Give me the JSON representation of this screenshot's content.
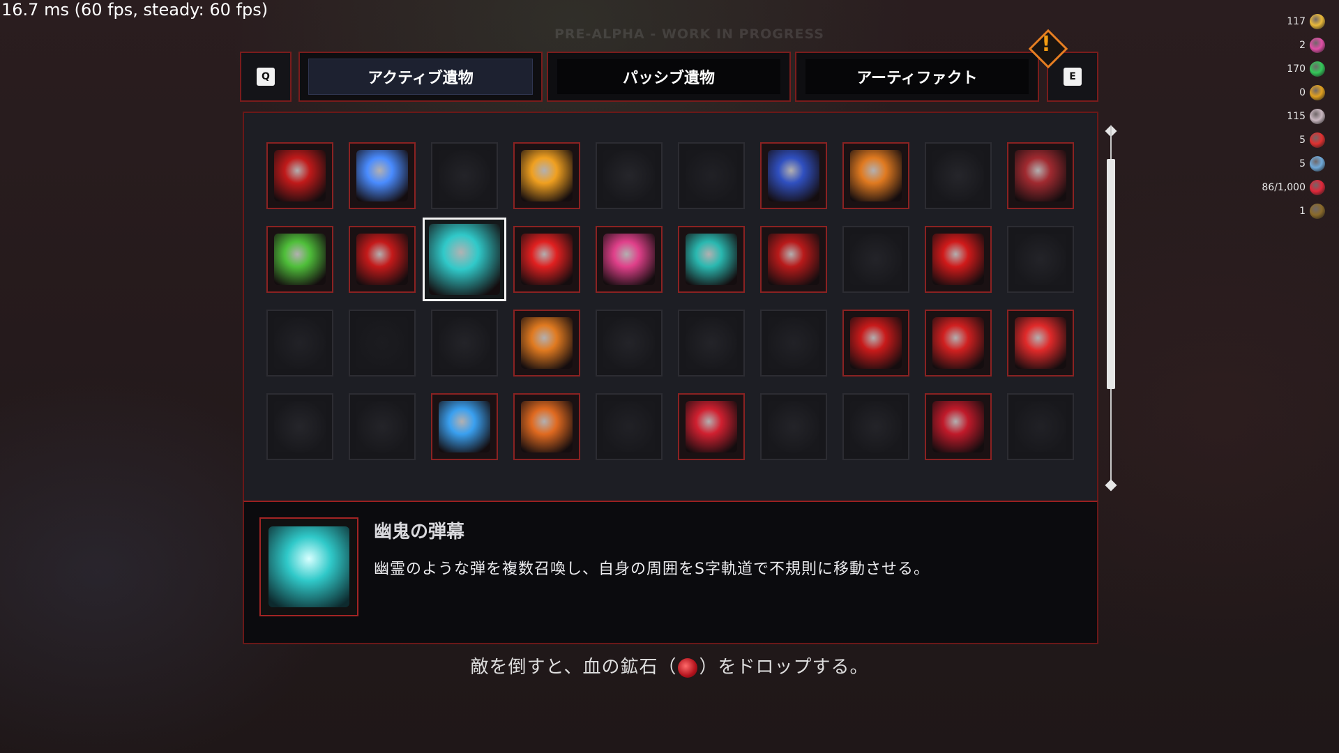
{
  "debug": {
    "fps_text": "16.7 ms (60 fps, steady: 60 fps)",
    "watermark": "PRE-ALPHA - WORK IN PROGRESS"
  },
  "resources": [
    {
      "value": "117",
      "icon": "gold-icon",
      "color": "#e9b93a"
    },
    {
      "value": "2",
      "icon": "pink-crystal-icon",
      "color": "#e04fa6"
    },
    {
      "value": "170",
      "icon": "green-gem-icon",
      "color": "#34c759"
    },
    {
      "value": "0",
      "icon": "gold-coin-icon",
      "color": "#e0a020"
    },
    {
      "value": "115",
      "icon": "spiky-bone-icon",
      "color": "#c9b7c0"
    },
    {
      "value": "5",
      "icon": "red-shard-icon",
      "color": "#e03030"
    },
    {
      "value": "5",
      "icon": "blue-gold-ore-icon",
      "color": "#6fa8d8"
    },
    {
      "value": "86/1,000",
      "icon": "blood-ore-icon",
      "color": "#e0283a"
    },
    {
      "value": "1",
      "icon": "wood-icon",
      "color": "#8a6a2a"
    }
  ],
  "tabs": {
    "left_key": "Q",
    "right_key": "E",
    "items": [
      {
        "label": "アクティブ遺物",
        "active": true
      },
      {
        "label": "パッシブ遺物",
        "active": false
      },
      {
        "label": "アーティファクト",
        "active": false
      }
    ]
  },
  "grid": {
    "slots": [
      {
        "icon": "red-slash-icon",
        "state": "owned",
        "color": "#c01a1a"
      },
      {
        "icon": "blue-skull-icon",
        "state": "owned",
        "color": "#4a8cff"
      },
      {
        "icon": "dark-eye-icon",
        "state": "locked",
        "color": "#303036"
      },
      {
        "icon": "fire-moon-icon",
        "state": "owned",
        "color": "#f0a020"
      },
      {
        "icon": "beast-jaw-icon",
        "state": "locked",
        "color": "#34343a"
      },
      {
        "icon": "shadow-wave-icon",
        "state": "locked",
        "color": "#2a2a30"
      },
      {
        "icon": "dark-vortex-icon",
        "state": "owned",
        "color": "#3050c0"
      },
      {
        "icon": "fire-beast-icon",
        "state": "owned",
        "color": "#e07a20"
      },
      {
        "icon": "sword-icon",
        "state": "locked",
        "color": "#34343a"
      },
      {
        "icon": "blood-cluster-icon",
        "state": "owned",
        "color": "#a02a30"
      },
      {
        "icon": "green-rat-icon",
        "state": "owned",
        "color": "#4fbf3a"
      },
      {
        "icon": "red-crystal-icon",
        "state": "owned",
        "color": "#c41a1a"
      },
      {
        "icon": "ghost-figure-icon",
        "state": "selected",
        "color": "#30c9c9"
      },
      {
        "icon": "red-lightning-icon",
        "state": "owned",
        "color": "#e02020"
      },
      {
        "icon": "pink-burst-icon",
        "state": "owned",
        "color": "#e0408a"
      },
      {
        "icon": "teal-rune-icon",
        "state": "owned",
        "color": "#2ab8b0"
      },
      {
        "icon": "red-spirit-icon",
        "state": "owned",
        "color": "#b81a1a"
      },
      {
        "icon": "orbit-icon",
        "state": "locked",
        "color": "#303036"
      },
      {
        "icon": "red-arc-icon",
        "state": "owned",
        "color": "#d01a1a"
      },
      {
        "icon": "dark-ring-icon",
        "state": "locked",
        "color": "#303036"
      },
      {
        "icon": "dark-demon-icon",
        "state": "locked",
        "color": "#2c2c32"
      },
      {
        "icon": "black-hole-icon",
        "state": "locked",
        "color": "#202024"
      },
      {
        "icon": "smoke-icon",
        "state": "locked",
        "color": "#303036"
      },
      {
        "icon": "meteor-shower-icon",
        "state": "owned",
        "color": "#e07a20"
      },
      {
        "icon": "spider-icon",
        "state": "locked",
        "color": "#303036"
      },
      {
        "icon": "stone-figure-icon",
        "state": "locked",
        "color": "#303036"
      },
      {
        "icon": "spikes-icon",
        "state": "locked",
        "color": "#2c2c32"
      },
      {
        "icon": "blood-claw-icon",
        "state": "owned",
        "color": "#c81a1a"
      },
      {
        "icon": "blood-scythe-icon",
        "state": "owned",
        "color": "#d02020"
      },
      {
        "icon": "blood-strike-icon",
        "state": "owned",
        "color": "#e02a2a"
      },
      {
        "icon": "spiked-ball-icon",
        "state": "locked",
        "color": "#34343a"
      },
      {
        "icon": "dark-star-icon",
        "state": "locked",
        "color": "#303036"
      },
      {
        "icon": "blue-lightning-icon",
        "state": "owned",
        "color": "#3aa0f0"
      },
      {
        "icon": "fire-skull-icon",
        "state": "owned",
        "color": "#e06a20"
      },
      {
        "icon": "dark-beast-icon",
        "state": "locked",
        "color": "#2a2a30"
      },
      {
        "icon": "blood-eye-beam-icon",
        "state": "owned",
        "color": "#d02030"
      },
      {
        "icon": "dark-leaf-icon",
        "state": "locked",
        "color": "#303036"
      },
      {
        "icon": "shadow-dash-icon",
        "state": "locked",
        "color": "#303036"
      },
      {
        "icon": "blood-eye-icon",
        "state": "owned",
        "color": "#c01a2a"
      },
      {
        "icon": "dark-storm-icon",
        "state": "locked",
        "color": "#2a2a30"
      }
    ]
  },
  "detail": {
    "title": "幽鬼の弾幕",
    "description": "幽霊のような弾を複数召喚し、自身の周囲をS字軌道で不規則に移動させる。",
    "icon": "ghost-figure-icon",
    "color": "#30c9c9"
  },
  "hint": {
    "before": "敵を倒すと、血の鉱石（",
    "after": "）をドロップする。",
    "icon": "blood-ore-icon"
  }
}
